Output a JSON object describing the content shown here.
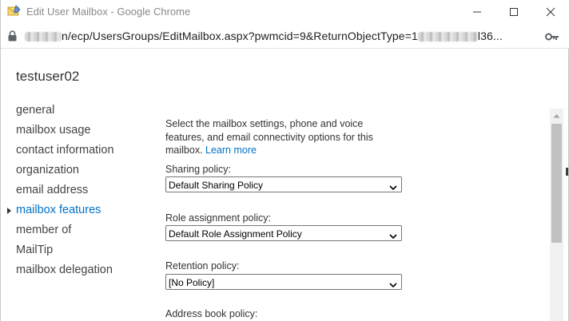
{
  "window": {
    "title": "Edit User Mailbox - Google Chrome",
    "minimize_label": "—",
    "maximize_label": "☐",
    "close_label": "✕"
  },
  "address": {
    "url_visible_part": "n/ecp/UsersGroups/EditMailbox.aspx?pwmcid=9&ReturnObjectType=1",
    "url_tail": "l36..."
  },
  "page": {
    "user_name": "testuser02",
    "nav": [
      {
        "label": "general",
        "active": false
      },
      {
        "label": "mailbox usage",
        "active": false
      },
      {
        "label": "contact information",
        "active": false
      },
      {
        "label": "organization",
        "active": false
      },
      {
        "label": "email address",
        "active": false
      },
      {
        "label": "mailbox features",
        "active": true
      },
      {
        "label": "member of",
        "active": false
      },
      {
        "label": "MailTip",
        "active": false
      },
      {
        "label": "mailbox delegation",
        "active": false
      }
    ],
    "intro_text": "Select the mailbox settings, phone and voice features, and email connectivity options for this mailbox.",
    "learn_more": "Learn more",
    "sharing_policy": {
      "label": "Sharing policy:",
      "value": "Default Sharing Policy"
    },
    "role_assignment_policy": {
      "label": "Role assignment policy:",
      "value": "Default Role Assignment Policy"
    },
    "retention_policy": {
      "label": "Retention policy:",
      "value": "[No Policy]"
    },
    "address_book_policy": {
      "label": "Address book policy:"
    }
  },
  "colors": {
    "accent": "#0072c6",
    "text": "#333333",
    "scroll_thumb": "#c1c1c1"
  }
}
